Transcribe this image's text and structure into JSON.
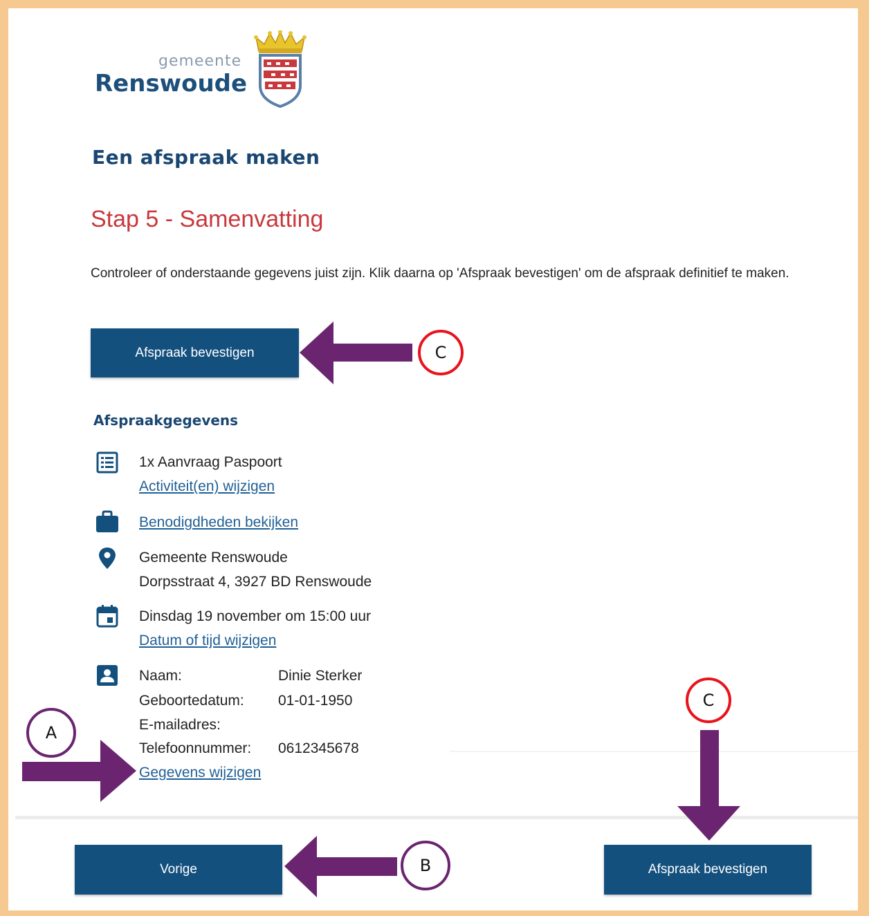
{
  "header": {
    "logo_small": "gemeente",
    "logo_big": "Renswoude",
    "page_title": "Een afspraak maken"
  },
  "step": {
    "title": "Stap 5 - Samenvatting",
    "intro": "Controleer of onderstaande gegevens juist zijn. Klik daarna op 'Afspraak bevestigen' om de afspraak definitief te maken."
  },
  "buttons": {
    "confirm_top": "Afspraak bevestigen",
    "previous": "Vorige",
    "confirm_bottom": "Afspraak bevestigen"
  },
  "details": {
    "section_title": "Afspraakgegevens",
    "activity": "1x Aanvraag Paspoort",
    "activity_link": "Activiteit(en) wijzigen",
    "requirements_link": "Benodigdheden bekijken",
    "location_name": "Gemeente Renswoude",
    "location_address": "Dorpsstraat 4, 3927 BD Renswoude",
    "datetime": "Dinsdag 19 november om 15:00 uur",
    "datetime_link": "Datum of tijd wijzigen",
    "person": {
      "name_label": "Naam:",
      "name_value": "Dinie Sterker",
      "dob_label": "Geboortedatum:",
      "dob_value": "01-01-1950",
      "email_label": "E-mailadres:",
      "email_value": "",
      "phone_label": "Telefoonnummer:",
      "phone_value": "0612345678"
    },
    "edit_link": "Gegevens wijzigen"
  },
  "annotations": {
    "a": "A",
    "b": "B",
    "c": "C",
    "purple": "#6b2570",
    "red": "#e8131c"
  },
  "icons": [
    "list-icon",
    "briefcase-icon",
    "location-pin-icon",
    "calendar-icon",
    "contact-card-icon"
  ],
  "colors": {
    "button": "#14507e",
    "heading": "#1a4772",
    "step_title": "#c8383c",
    "link": "#1f5f95",
    "frame": "#f5c990"
  }
}
